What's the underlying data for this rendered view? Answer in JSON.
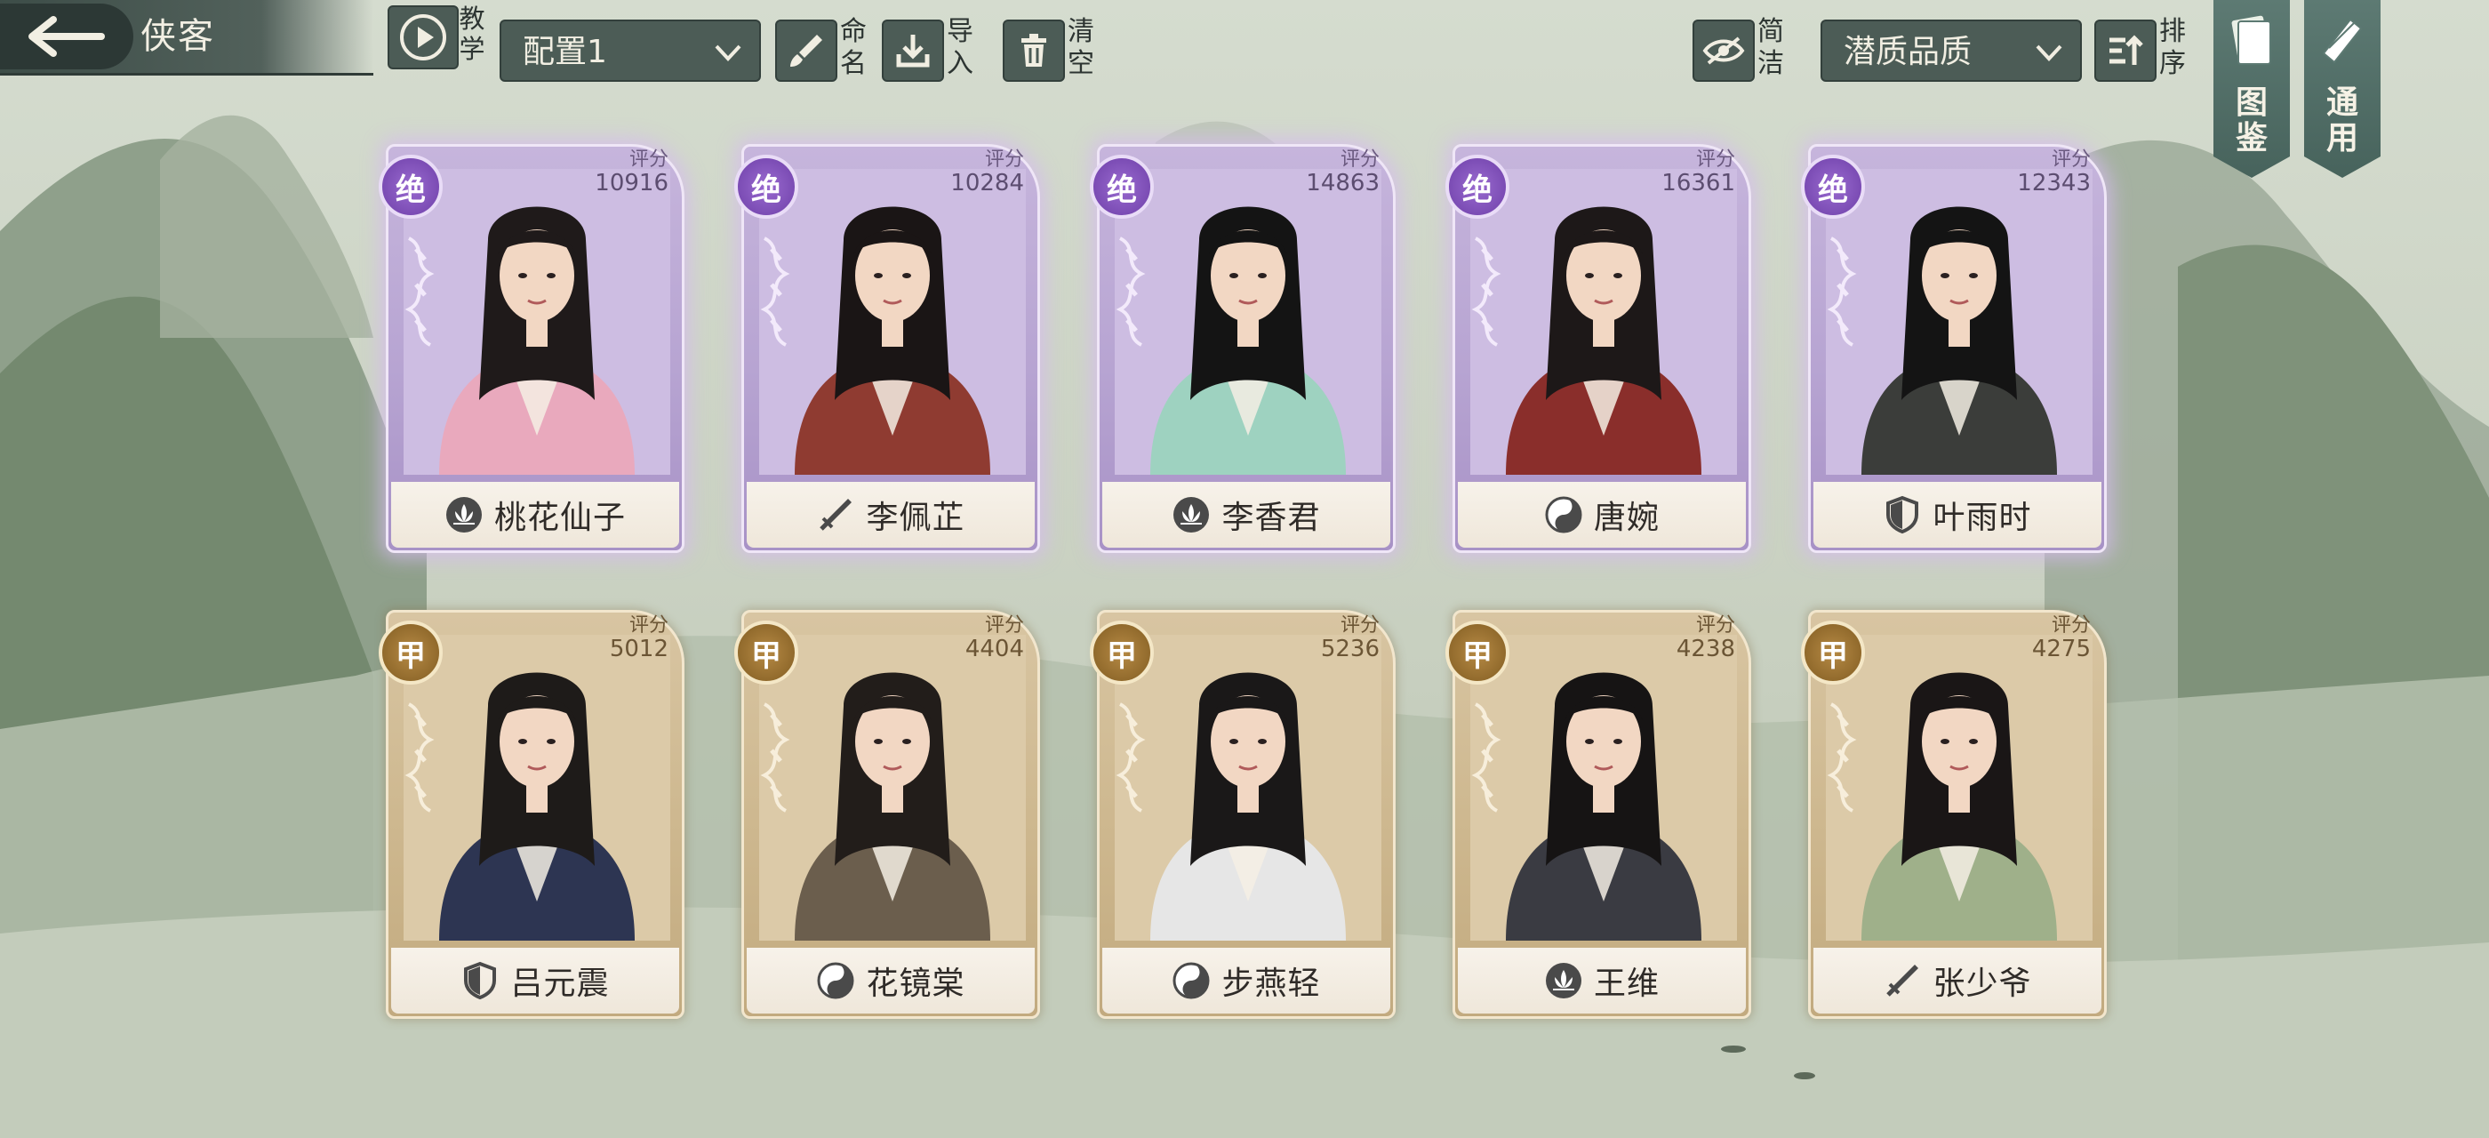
{
  "header": {
    "title": "侠客",
    "tutorial_label": "教学",
    "config_select": "配置1",
    "rename_label": "命名",
    "import_label": "导入",
    "clear_label": "清空",
    "simple_label": "简洁",
    "sort_select": "潜质品质",
    "sort_label": "排序",
    "codex_label": "图鉴",
    "general_label": "通用"
  },
  "cards": [
    {
      "name": "桃花仙子",
      "grade": "绝",
      "score_label": "评分",
      "score": "10916",
      "tier": "purple",
      "role_icon": "lotus-icon"
    },
    {
      "name": "李佩芷",
      "grade": "绝",
      "score_label": "评分",
      "score": "10284",
      "tier": "purple",
      "role_icon": "sword-icon"
    },
    {
      "name": "李香君",
      "grade": "绝",
      "score_label": "评分",
      "score": "14863",
      "tier": "purple",
      "role_icon": "lotus-icon"
    },
    {
      "name": "唐婉",
      "grade": "绝",
      "score_label": "评分",
      "score": "16361",
      "tier": "purple",
      "role_icon": "taiji-icon"
    },
    {
      "name": "叶雨时",
      "grade": "绝",
      "score_label": "评分",
      "score": "12343",
      "tier": "purple",
      "role_icon": "shield-icon"
    },
    {
      "name": "吕元震",
      "grade": "甲",
      "score_label": "评分",
      "score": "5012",
      "tier": "gold",
      "role_icon": "shield-icon"
    },
    {
      "name": "花镜棠",
      "grade": "甲",
      "score_label": "评分",
      "score": "4404",
      "tier": "gold",
      "role_icon": "taiji-icon"
    },
    {
      "name": "步燕轻",
      "grade": "甲",
      "score_label": "评分",
      "score": "5236",
      "tier": "gold",
      "role_icon": "taiji-icon"
    },
    {
      "name": "王维",
      "grade": "甲",
      "score_label": "评分",
      "score": "4238",
      "tier": "gold",
      "role_icon": "lotus-icon"
    },
    {
      "name": "张少爷",
      "grade": "甲",
      "score_label": "评分",
      "score": "4275",
      "tier": "gold",
      "role_icon": "sword-icon"
    }
  ],
  "colors": {
    "purple_card": "#b7a4d2",
    "gold_card": "#cdb78e",
    "bar_button": "#4c5c56",
    "banner": "#5d7a73"
  }
}
